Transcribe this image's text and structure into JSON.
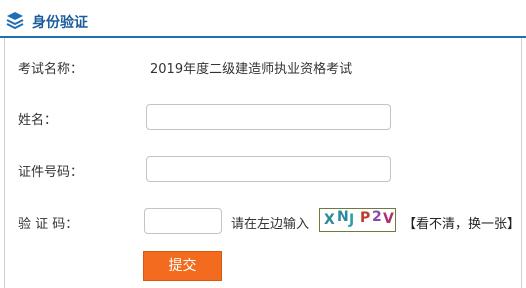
{
  "header": {
    "title": "身份验证",
    "icon": "layers-icon",
    "accent_color": "#1f6fb5"
  },
  "form": {
    "exam_name": {
      "label": "考试名称：",
      "value": "2019年度二级建造师执业资格考试"
    },
    "name": {
      "label": "姓名：",
      "value": ""
    },
    "id_number": {
      "label": "证件号码：",
      "value": ""
    },
    "captcha": {
      "label": "验 证 码：",
      "value": "",
      "prompt": "请在左边输入",
      "image_text": [
        "X",
        "N",
        "J",
        "P",
        "2",
        "V"
      ],
      "image_colors": [
        "#2a8a9a",
        "#2a8a9a",
        "#2aa2a0",
        "#c0392b",
        "#8e44ad",
        "#b0306a"
      ],
      "refresh_label": "【看不清，换一张】"
    },
    "submit_label": "提交",
    "submit_color": "#f26b1f"
  }
}
